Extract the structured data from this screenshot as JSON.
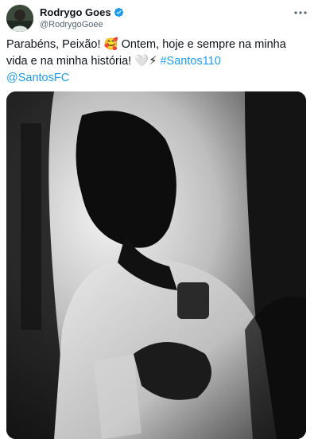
{
  "tweet": {
    "author": {
      "display_name": "Rodrygo Goes",
      "handle": "@RodrygoGoee",
      "verified": true
    },
    "text": {
      "part1": "Parabéns, Peixão! ",
      "emoji1": "🥰",
      "part2": " Ontem, hoje e sempre na minha vida e na minha história! ",
      "emoji2": "🤍⚡",
      "hashtag": "#Santos110",
      "mention": "@SantosFC"
    },
    "colors": {
      "link": "#1d9bf0",
      "text": "#0f1419",
      "secondary": "#536471"
    },
    "icons": [
      "verified-badge-icon",
      "more-options-icon"
    ]
  }
}
